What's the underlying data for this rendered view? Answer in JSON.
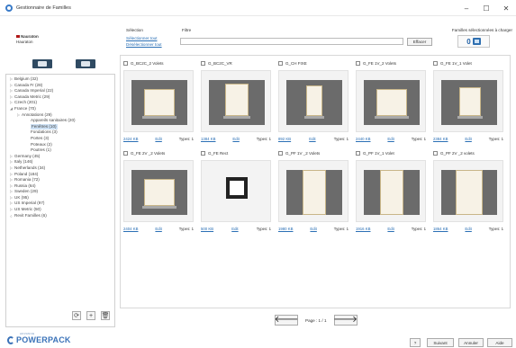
{
  "window": {
    "title": "Gestionnaire de Familles",
    "controls": [
      "–",
      "☐",
      "✕"
    ]
  },
  "revit": {
    "label1": "Nauraton",
    "label2": "Hauraton"
  },
  "tree": [
    {
      "label": "Belgium (32)",
      "level": 0,
      "arrow": "▷"
    },
    {
      "label": "Canada Fr (28)",
      "level": 0,
      "arrow": "▷"
    },
    {
      "label": "Canada Imperial (22)",
      "level": 0,
      "arrow": "▷"
    },
    {
      "label": "Canada Metric (29)",
      "level": 0,
      "arrow": "▷"
    },
    {
      "label": "Czech (201)",
      "level": 0,
      "arrow": "▷"
    },
    {
      "label": "France (70)",
      "level": 0,
      "arrow": "◢"
    },
    {
      "label": "Annotations (29)",
      "level": 1,
      "arrow": "▷"
    },
    {
      "label": "Appareils sanitaires (20)",
      "level": 2,
      "arrow": ""
    },
    {
      "label": "Fenêtres (10)",
      "level": 2,
      "arrow": "",
      "selected": true
    },
    {
      "label": "Fondations (3)",
      "level": 2,
      "arrow": ""
    },
    {
      "label": "Portes (3)",
      "level": 2,
      "arrow": ""
    },
    {
      "label": "Poteaux (2)",
      "level": 2,
      "arrow": ""
    },
    {
      "label": "Poutres (1)",
      "level": 2,
      "arrow": ""
    },
    {
      "label": "Germany (45)",
      "level": 0,
      "arrow": "▷"
    },
    {
      "label": "Italy (146)",
      "level": 0,
      "arrow": "▷"
    },
    {
      "label": "Netherlands (34)",
      "level": 0,
      "arrow": "▷"
    },
    {
      "label": "Poland (184)",
      "level": 0,
      "arrow": "▷"
    },
    {
      "label": "Romania (72)",
      "level": 0,
      "arrow": "▷"
    },
    {
      "label": "Russia (64)",
      "level": 0,
      "arrow": "▷"
    },
    {
      "label": "Sweden (29)",
      "level": 0,
      "arrow": "▷"
    },
    {
      "label": "UK (95)",
      "level": 0,
      "arrow": "▷"
    },
    {
      "label": "US Imperial (97)",
      "level": 0,
      "arrow": "▷"
    },
    {
      "label": "US Metric (50)",
      "level": 0,
      "arrow": "▷"
    },
    {
      "label": "Revit Familles (6)",
      "level": 0,
      "arrow": "¿"
    }
  ],
  "selection": {
    "label": "Sélection",
    "select_all": "Sélectionner tout",
    "deselect_all": "Désélectionner tout"
  },
  "filter": {
    "label": "Filtre",
    "value": "",
    "clear_label": "Effacer"
  },
  "families_selected": {
    "label": "Familles sélectionnées à charger",
    "count": "0"
  },
  "cards": [
    {
      "name": "G_BC2C_2 Volets",
      "size": "2424 KB",
      "edit": "Edit",
      "types": "Types: 1",
      "style": "double"
    },
    {
      "name": "G_BC2C_VR",
      "size": "1384 KB",
      "edit": "Edit",
      "types": "Types: 1",
      "style": "vr"
    },
    {
      "name": "G_CH FIXE",
      "size": "892 KB",
      "edit": "Edit",
      "types": "Types: 1",
      "style": "fixe"
    },
    {
      "name": "G_FE 1V_2 Volets",
      "size": "2440 KB",
      "edit": "Edit",
      "types": "Types: 1",
      "style": "double"
    },
    {
      "name": "G_FE 1V_1 Volet",
      "size": "2384 KB",
      "edit": "Edit",
      "types": "Types: 1",
      "style": "single"
    },
    {
      "name": "G_FE 2V _2 Volets",
      "size": "2404 KB",
      "edit": "Edit",
      "types": "Types: 1",
      "style": "double"
    },
    {
      "name": "G_FE Rect",
      "size": "500 KB",
      "edit": "Edit",
      "types": "Types: 1",
      "style": "rect"
    },
    {
      "name": "G_PF 1V _2 Volets",
      "size": "1980 KB",
      "edit": "Edit",
      "types": "Types: 1",
      "style": "door"
    },
    {
      "name": "G_PF 1V_1 Volet",
      "size": "1916 KB",
      "edit": "Edit",
      "types": "Types: 1",
      "style": "door"
    },
    {
      "name": "G_PF 2V _2 volets",
      "size": "1864 KB",
      "edit": "Edit",
      "types": "Types: 1",
      "style": "door2"
    }
  ],
  "pager": {
    "text": "Page : 1 / 1",
    "prev": "🡐",
    "next": "🡒"
  },
  "left_buttons": [
    "⟳",
    "+",
    "🗑"
  ],
  "brand": {
    "small": "ADVANCE",
    "name": "POWERPACK"
  },
  "footer_buttons": {
    "help": "?",
    "next": "Suivant",
    "cancel": "Annuler",
    "aide": "Aide"
  }
}
